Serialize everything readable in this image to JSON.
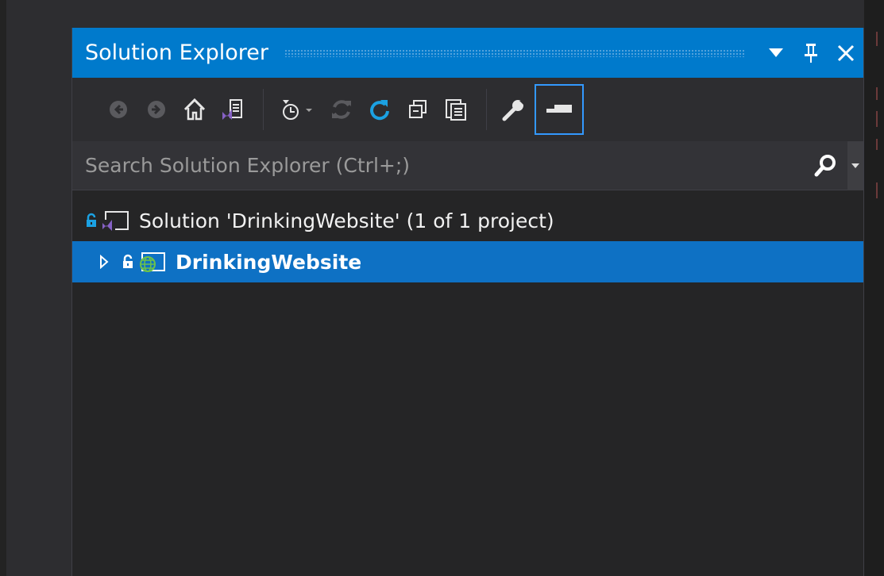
{
  "panel": {
    "title": "Solution Explorer",
    "title_buttons": [
      "window-position-dropdown",
      "pin",
      "close"
    ]
  },
  "toolbar": {
    "buttons": [
      "back-icon",
      "forward-icon",
      "home-icon",
      "switch-views-icon",
      "pending-changes-filter-icon",
      "sync-icon",
      "refresh-icon",
      "collapse-all-icon",
      "show-all-files-icon",
      "properties-icon",
      "preview-selected-items-icon"
    ]
  },
  "search": {
    "placeholder": "Search Solution Explorer (Ctrl+;)"
  },
  "tree": {
    "solution_label": "Solution 'DrinkingWebsite' (1 of 1 project)",
    "project_label": "DrinkingWebsite"
  },
  "colors": {
    "accent": "#007acc",
    "selection": "#0e71c4",
    "background": "#252526",
    "vs_purple": "#8661c5",
    "web_green": "#6cc24a"
  }
}
